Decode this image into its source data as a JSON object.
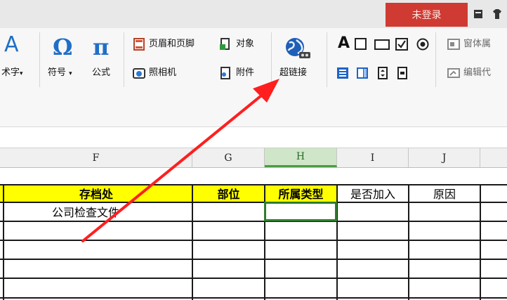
{
  "titlebar": {
    "login_label": "未登录"
  },
  "ribbon": {
    "wordart_label": "术字",
    "symbol_label": "符号",
    "formula_label": "公式",
    "header_footer_label": "页眉和页脚",
    "object_label": "对象",
    "camera_label": "照相机",
    "attachment_label": "附件",
    "hyperlink_label": "超链接",
    "form_text_glyph": "A",
    "window_body_label": "窗体属",
    "edit_code_label": "编辑代"
  },
  "columns": [
    "F",
    "G",
    "H",
    "I",
    "J"
  ],
  "active_column": "H",
  "table": {
    "headers": [
      "存档处",
      "部位",
      "所属类型",
      "是否加入",
      "原因"
    ],
    "rows": [
      [
        "公司检查文件",
        "",
        "",
        "",
        ""
      ],
      [
        "",
        "",
        "",
        "",
        ""
      ],
      [
        "",
        "",
        "",
        "",
        ""
      ],
      [
        "",
        "",
        "",
        "",
        ""
      ]
    ]
  },
  "colors": {
    "login_bg": "#cf3b32",
    "header_yellow": "#ffff00",
    "arrow": "#ff1f1f",
    "selection": "#2f7d2c"
  }
}
